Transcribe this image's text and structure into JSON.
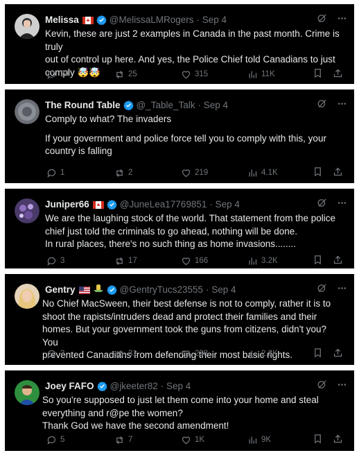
{
  "tweets": [
    {
      "name": "Melissa",
      "handle": "@MelissaLMRogers",
      "date": "· Sep 4",
      "flag": "canada",
      "lines": [
        "Kevin, these are just 2 examples in Canada in the past month. Crime is truly",
        "out of control up here. And yes, the Police Chief told Canadians to just",
        "comply 🤯🤯"
      ],
      "replies": "24",
      "retweets": "25",
      "likes": "315",
      "views": "11K"
    },
    {
      "name": "The Round Table",
      "handle": "@_Table_Talk",
      "date": "· Sep 4",
      "lines": [
        "Comply to what? The invaders",
        "",
        "If your government and police force tell you to comply with this, your",
        "country is falling"
      ],
      "replies": "1",
      "retweets": "2",
      "likes": "219",
      "views": "4.1K"
    },
    {
      "name": "Juniper66",
      "handle": "@JuneLea17769851",
      "date": "· Sep 4",
      "flag": "canada",
      "lines": [
        "We are the laughing stock of the world. That statement from the police",
        "chief just told the criminals to go ahead, nothing will be done.",
        "In rural places, there's no such thing as home invasions........"
      ],
      "replies": "3",
      "retweets": "17",
      "likes": "166",
      "views": "3.2K"
    },
    {
      "name": "Gentry",
      "handle": "@GentryTucs23555",
      "date": "· Sep 4",
      "flag": "usa",
      "lines": [
        "No Chief MacSween, their best defense is not to comply, rather it is to",
        "shoot the rapists/intruders dead and protect their families and their",
        "homes. But your government took the guns from citizens, didn't you? You",
        "prevented Canadians from defending their most basic rights."
      ],
      "replies": "3",
      "retweets": "31",
      "likes": "238",
      "views": "2.6K"
    },
    {
      "name": "Joey FAFO",
      "handle": "@jkeeter82",
      "date": "· Sep 4",
      "lines": [
        "So you're supposed to just let them come into your home and steal",
        "everything and r@pe the women?",
        "Thank God we have the second amendment!"
      ],
      "replies": "5",
      "retweets": "7",
      "likes": "1K",
      "views": "9K"
    }
  ],
  "colors": {
    "background": "#000000",
    "text": "#e7e9ea",
    "muted": "#71767b",
    "verified": "#1d9bf0"
  }
}
